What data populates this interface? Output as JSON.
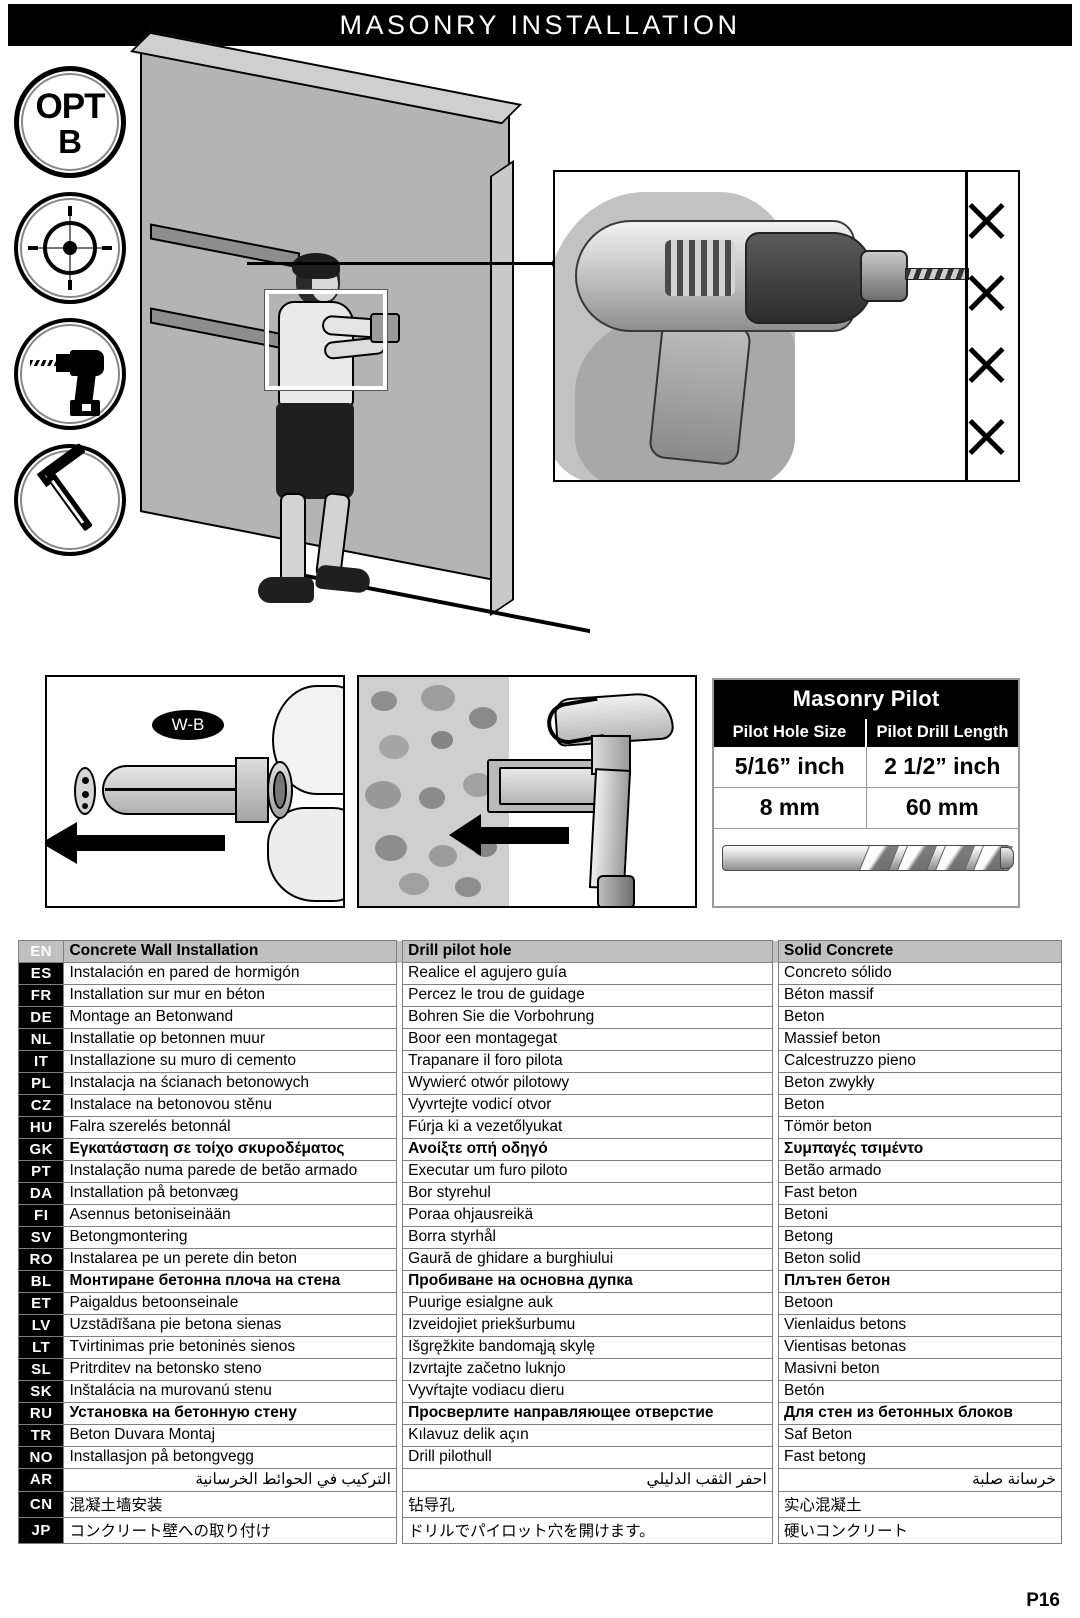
{
  "header": {
    "title": "MASONRY INSTALLATION"
  },
  "icons": [
    {
      "name": "opt-b-icon",
      "label": "OPT",
      "sub": "B"
    },
    {
      "name": "target-crosshair-icon",
      "label": ""
    },
    {
      "name": "drill-icon",
      "label": ""
    },
    {
      "name": "hammer-icon",
      "label": ""
    }
  ],
  "anchor_panel": {
    "badge": "W-B"
  },
  "pilot_table": {
    "title": "Masonry Pilot",
    "col1_header": "Pilot Hole Size",
    "col2_header": "Pilot Drill Length",
    "rows": [
      {
        "size": "5/16” inch",
        "length": "2 1/2” inch"
      },
      {
        "size": "8 mm",
        "length": "60 mm"
      }
    ]
  },
  "lang_table": {
    "columns": [
      "Concrete Wall Installation",
      "Drill pilot hole",
      "Solid Concrete"
    ],
    "rows": [
      {
        "code": "EN",
        "c1": "Concrete Wall Installation",
        "c2": "Drill pilot hole",
        "c3": "Solid Concrete",
        "header": true
      },
      {
        "code": "ES",
        "c1": "Instalación en pared de hormigón",
        "c2": "Realice el agujero guía",
        "c3": "Concreto sólido"
      },
      {
        "code": "FR",
        "c1": "Installation sur mur en béton",
        "c2": "Percez le trou de guidage",
        "c3": "Béton massif"
      },
      {
        "code": "DE",
        "c1": "Montage an Betonwand",
        "c2": "Bohren Sie die Vorbohrung",
        "c3": "Beton"
      },
      {
        "code": "NL",
        "c1": "Installatie op betonnen muur",
        "c2": "Boor een montagegat",
        "c3": "Massief beton"
      },
      {
        "code": "IT",
        "c1": "Installazione su muro di cemento",
        "c2": "Trapanare il foro pilota",
        "c3": "Calcestruzzo pieno"
      },
      {
        "code": "PL",
        "c1": "Instalacja na ścianach betonowych",
        "c2": "Wywierć otwór pilotowy",
        "c3": "Beton zwykły"
      },
      {
        "code": "CZ",
        "c1": "Instalace na betonovou stěnu",
        "c2": "Vyvrtejte vodicí otvor",
        "c3": "Beton"
      },
      {
        "code": "HU",
        "c1": "Falra szerelés betonnál",
        "c2": "Fúrja ki a vezetőlyukat",
        "c3": "Tömör beton"
      },
      {
        "code": "GK",
        "c1": "Εγκατάσταση σε τοίχο σκυροδέματος",
        "c2": "Ανοίξτε οπή οδηγό",
        "c3": "Συμπαγές τσιμέντο",
        "bold": true
      },
      {
        "code": "PT",
        "c1": "Instalação numa parede de betão armado",
        "c2": "Executar um furo piloto",
        "c3": "Betão armado"
      },
      {
        "code": "DA",
        "c1": "Installation på betonvæg",
        "c2": "Bor styrehul",
        "c3": "Fast beton"
      },
      {
        "code": "FI",
        "c1": "Asennus betoniseinään",
        "c2": "Poraa ohjausreikä",
        "c3": "Betoni"
      },
      {
        "code": "SV",
        "c1": "Betongmontering",
        "c2": "Borra styrhål",
        "c3": "Betong"
      },
      {
        "code": "RO",
        "c1": "Instalarea pe un perete din beton",
        "c2": "Gaură de ghidare a burghiului",
        "c3": "Beton solid"
      },
      {
        "code": "BL",
        "c1": "Монтиране бетонна плоча на стена",
        "c2": "Пробиване на основна дупка",
        "c3": "Плътен бетон",
        "bold": true
      },
      {
        "code": "ET",
        "c1": "Paigaldus betoonseinale",
        "c2": "Puurige esialgne auk",
        "c3": "Betoon"
      },
      {
        "code": "LV",
        "c1": "Uzstādīšana pie betona sienas",
        "c2": "Izveidojiet priekšurbumu",
        "c3": "Vienlaidus betons"
      },
      {
        "code": "LT",
        "c1": "Tvirtinimas prie betoninės sienos",
        "c2": "Išgręžkite bandomąją skylę",
        "c3": "Vientisas betonas"
      },
      {
        "code": "SL",
        "c1": "Pritrditev na betonsko steno",
        "c2": "Izvrtajte začetno luknjo",
        "c3": "Masivni beton"
      },
      {
        "code": "SK",
        "c1": "Inštalácia na murovanú stenu",
        "c2": "Vyvŕtajte vodiacu dieru",
        "c3": "Betón"
      },
      {
        "code": "RU",
        "c1": "Установка на бетонную стену",
        "c2": "Просверлите направляющее отверстие",
        "c3": "Для стен из бетонных блоков",
        "bold": true
      },
      {
        "code": "TR",
        "c1": "Beton Duvara Montaj",
        "c2": "Kılavuz delik açın",
        "c3": "Saf Beton"
      },
      {
        "code": "NO",
        "c1": "Installasjon på betongvegg",
        "c2": "Drill pilothull",
        "c3": "Fast betong"
      },
      {
        "code": "AR",
        "c1": "التركيب في الحوائط الخرسانية",
        "c2": "احفر الثقب الدليلي",
        "c3": "خرسانة صلبة",
        "rtl": true
      },
      {
        "code": "CN",
        "c1": "混凝土墙安装",
        "c2": "钻导孔",
        "c3": "实心混凝土",
        "cjk": true
      },
      {
        "code": "JP",
        "c1": "コンクリート壁への取り付け",
        "c2": "ドリルでパイロット穴を開けます。",
        "c3": "硬いコンクリート",
        "cjk": true
      }
    ]
  },
  "footer": {
    "page": "P16"
  }
}
